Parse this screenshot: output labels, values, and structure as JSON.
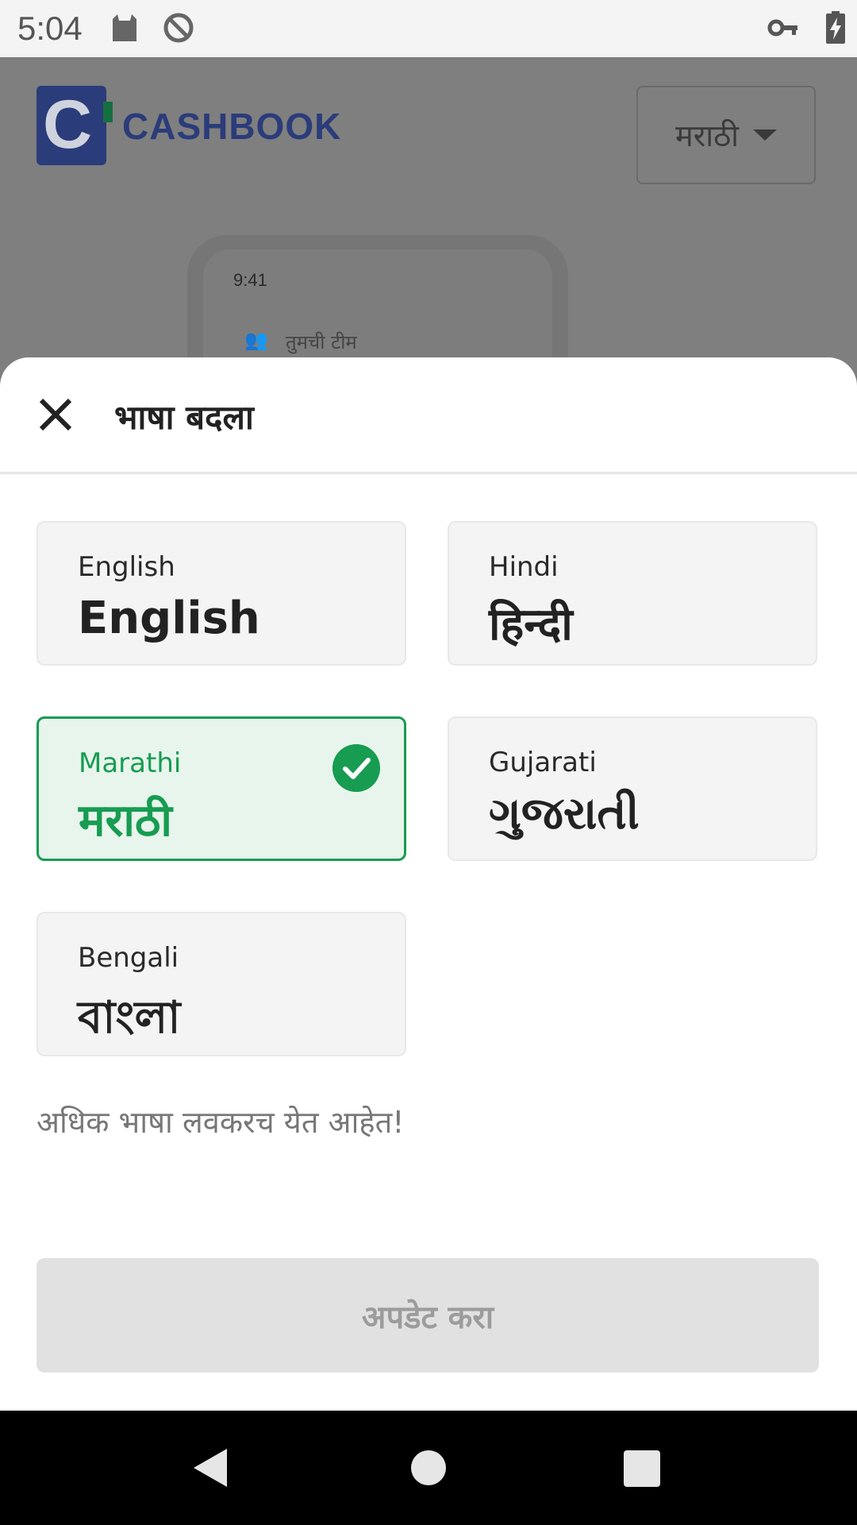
{
  "status_bar": {
    "time": "5:04",
    "icons": [
      "cat-icon",
      "sync-disabled-icon",
      "vpn-key-icon",
      "battery-charging-icon"
    ]
  },
  "background_app": {
    "brand": "CASHBOOK",
    "language_dropdown": "मराठी",
    "phone_preview": {
      "time": "9:41",
      "team_label": "तुमची टीम"
    }
  },
  "sheet": {
    "title": "भाषा बदला",
    "languages": [
      {
        "english_name": "English",
        "native_name": "English",
        "selected": false
      },
      {
        "english_name": "Hindi",
        "native_name": "हिन्दी",
        "selected": false
      },
      {
        "english_name": "Marathi",
        "native_name": "मराठी",
        "selected": true
      },
      {
        "english_name": "Gujarati",
        "native_name": "ગુજરાતી",
        "selected": false
      },
      {
        "english_name": "Bengali",
        "native_name": "বাংলা",
        "selected": false
      }
    ],
    "more_languages_note": "अधिक भाषा लवकरच येत आहेत!",
    "update_button": "अपडेट करा"
  },
  "colors": {
    "accent_green": "#179c52",
    "brand_blue": "#2b3c7a"
  }
}
